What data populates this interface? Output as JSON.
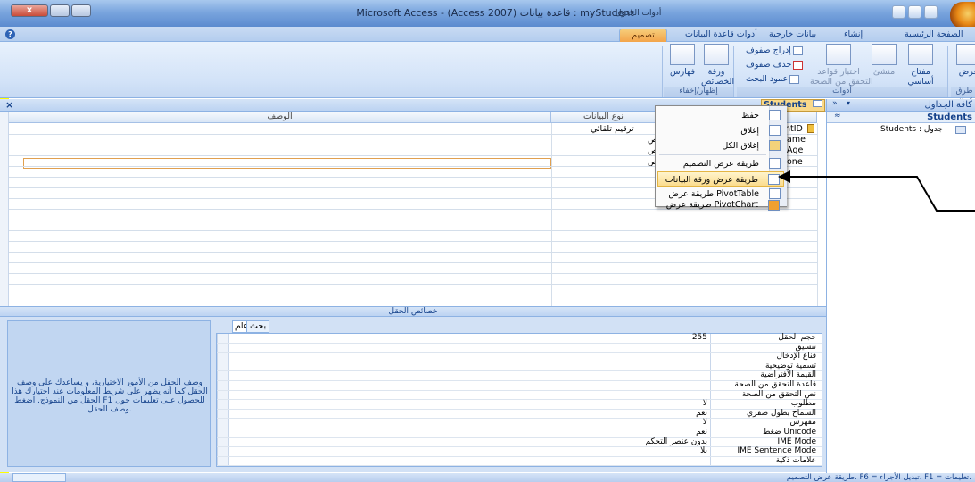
{
  "window": {
    "title": "Microsoft Access - (Access 2007) قاعدة بيانات : myStudent",
    "context_label": "أدوات الجدول",
    "close_glyph": "x"
  },
  "tabs": {
    "home": "الصفحة الرئيسية",
    "create": "إنشاء",
    "external": "بيانات خارجية",
    "db_tools": "أدوات قاعدة البيانات",
    "design": "تصميم"
  },
  "ribbon": {
    "view": "عرض",
    "primary_key_1": "مفتاح",
    "primary_key_2": "أساسي",
    "builder": "منشئ",
    "test_rules_1": "اختبار قواعد",
    "test_rules_2": "التحقق من الصحة",
    "insert_rows": "إدراج صفوف",
    "delete_rows": "حذف صفوف",
    "lookup_column": "عمود البحث",
    "property_sheet_1": "ورقة",
    "property_sheet_2": "الخصائص",
    "indexes": "فهارس",
    "group_views": "طرق عرض",
    "group_tools": "أدوات",
    "group_show_hide": "إظهار/إخفاء"
  },
  "nav": {
    "header": "كافة الجداول",
    "group": "Students",
    "item": "Students : جدول"
  },
  "document": {
    "tab_title": "Students",
    "close_glyph": "×",
    "col_description": "الوصف",
    "col_datatype": "نوع البيانات",
    "rows": [
      {
        "name": "ntID",
        "type": "ترقيم تلقائي"
      },
      {
        "name": "ame",
        "type": "نص"
      },
      {
        "name": "Age",
        "type": "نص"
      },
      {
        "name": "one",
        "type": "نص"
      }
    ]
  },
  "field_properties": {
    "bar_title": "خصائص الحقل",
    "tab_general": "عام",
    "tab_lookup": "بحث",
    "description": "وصف الحقل من الأمور الاختيارية، و يساعدك على وصف الحقل كما أنه يظهر على شريط المعلومات عند اختيارك هذا الحقل من النموذج. اضغط F1 للحصول على تعليمات حول وصف الحقل.",
    "rows": [
      {
        "label": "حجم الحقل",
        "value": "255"
      },
      {
        "label": "تنسيق",
        "value": ""
      },
      {
        "label": "قناع الإدخال",
        "value": ""
      },
      {
        "label": "تسمية توضيحية",
        "value": ""
      },
      {
        "label": "القيمة الافتراضية",
        "value": ""
      },
      {
        "label": "قاعدة التحقق من الصحة",
        "value": ""
      },
      {
        "label": "نص التحقق من الصحة",
        "value": ""
      },
      {
        "label": "مطلوب",
        "value": "لا"
      },
      {
        "label": "السماح بطول صفري",
        "value": "نعم"
      },
      {
        "label": "مفهرس",
        "value": "لا"
      },
      {
        "label": "ضغط Unicode",
        "value": "نعم"
      },
      {
        "label": "IME Mode",
        "value": "بدون عنصر التحكم"
      },
      {
        "label": "IME Sentence Mode",
        "value": "بلا"
      },
      {
        "label": "علامات ذكية",
        "value": ""
      }
    ]
  },
  "context_menu": {
    "items": [
      "حفظ",
      "إغلاق",
      "إغلاق الكل",
      "طريقة عرض التصميم",
      "طريقة عرض ورقة البيانات",
      "طريقة عرض PivotTable",
      "طريقة عرض PivotChart"
    ]
  },
  "status": {
    "text": "طريقة عرض التصميم. F6 = تبديل الأجزاء. F1 = تعليمات."
  },
  "colors": {
    "highlight": "#ffff00",
    "ribbon_blue": "#d3e3f8",
    "menu_highlight": "#fbdc8e"
  }
}
